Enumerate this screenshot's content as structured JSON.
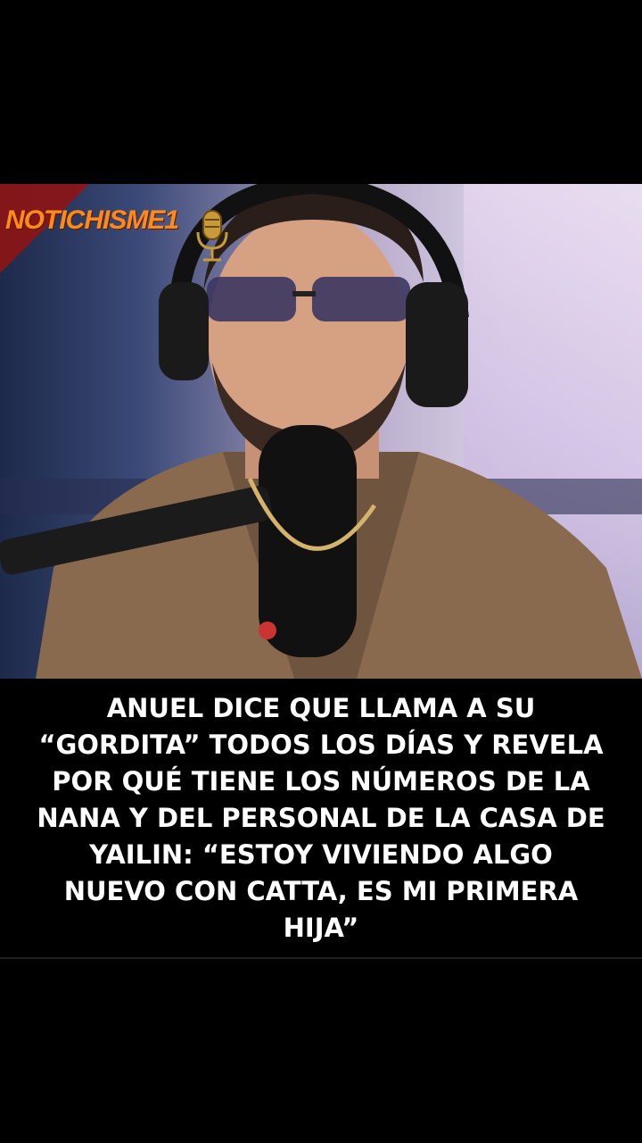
{
  "logo": {
    "text": "NOTICHISME1",
    "icon": "microphone-icon",
    "color": "#ff8a1c"
  },
  "photo": {
    "subject": "man-with-headphones-and-microphone"
  },
  "caption": {
    "text": "ANUEL DICE QUE LLAMA A SU “GORDITA” TODOS LOS DÍAS Y REVELA POR QUÉ TIENE LOS NÚMEROS DE LA NANA Y DEL PERSONAL DE LA CASA DE YAILIN: “ESTOY VIVIENDO ALGO NUEVO CON CATTA, ES MI PRIMERA HIJA”"
  }
}
